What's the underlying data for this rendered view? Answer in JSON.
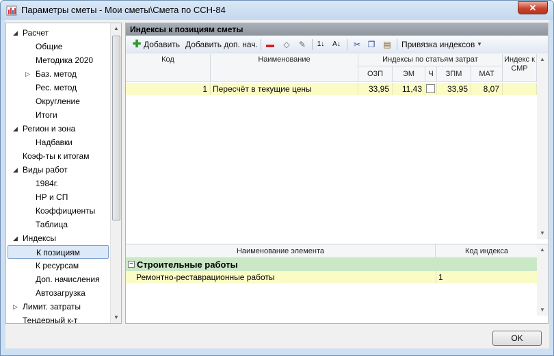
{
  "window": {
    "title": "Параметры сметы - Мои сметы\\Смета по ССН-84",
    "close_label": "✕"
  },
  "tree": {
    "items": [
      {
        "label": "Расчет",
        "level": 0,
        "expander": "▲"
      },
      {
        "label": "Общие",
        "level": 1
      },
      {
        "label": "Методика 2020",
        "level": 1
      },
      {
        "label": "Баз. метод",
        "level": 1,
        "expander": "▷"
      },
      {
        "label": "Рес. метод",
        "level": 1
      },
      {
        "label": "Округление",
        "level": 1
      },
      {
        "label": "Итоги",
        "level": 1
      },
      {
        "label": "Регион и зона",
        "level": 0,
        "expander": "▲"
      },
      {
        "label": "Надбавки",
        "level": 1
      },
      {
        "label": "Коэф-ты к итогам",
        "level": 0
      },
      {
        "label": "Виды работ",
        "level": 0,
        "expander": "▲"
      },
      {
        "label": "1984г.",
        "level": 1
      },
      {
        "label": "НР и СП",
        "level": 1
      },
      {
        "label": "Коэффициенты",
        "level": 1
      },
      {
        "label": "Таблица",
        "level": 1
      },
      {
        "label": "Индексы",
        "level": 0,
        "expander": "▲"
      },
      {
        "label": "К позициям",
        "level": 1,
        "selected": true
      },
      {
        "label": "К ресурсам",
        "level": 1
      },
      {
        "label": "Доп. начисления",
        "level": 1
      },
      {
        "label": "Автозагрузка",
        "level": 1
      },
      {
        "label": "Лимит. затраты",
        "level": 0,
        "expander": "▷"
      },
      {
        "label": "Тендерный к-т",
        "level": 0
      }
    ]
  },
  "panel": {
    "title": "Индексы к позициям сметы",
    "toolbar": {
      "add": "Добавить",
      "add_extra": "Добавить доп. нач.",
      "binding": "Привязка индексов"
    },
    "columns": {
      "code": "Код",
      "name": "Наименование",
      "group": "Индексы по статьям затрат",
      "ozp": "ОЗП",
      "em": "ЭМ",
      "ch": "Ч",
      "zpm": "ЗПМ",
      "mat": "МАТ",
      "smr": "Индекс к СМР"
    },
    "rows": [
      {
        "code": "1",
        "name": "Пересчёт в текущие цены",
        "ozp": "33,95",
        "em": "11,43",
        "zpm": "33,95",
        "mat": "8,07",
        "smr": ""
      }
    ],
    "lower": {
      "col_name": "Наименование элемента",
      "col_code": "Код индекса",
      "group": "Строительные работы",
      "element": {
        "name": "Ремонтно-реставрационные работы",
        "code": "1"
      }
    }
  },
  "ok_label": "OK"
}
